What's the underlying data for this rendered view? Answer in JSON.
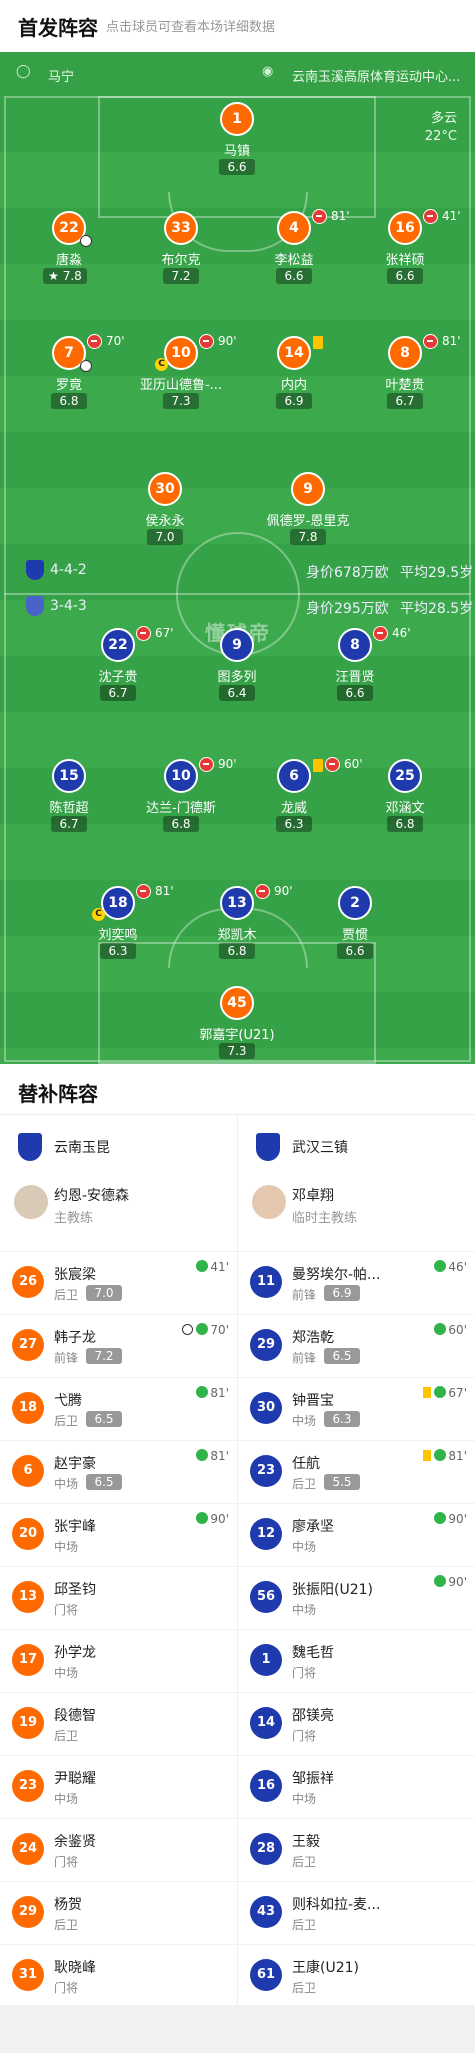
{
  "header": {
    "title": "首发阵容",
    "subtitle": "点击球员可查看本场详细数据"
  },
  "match": {
    "referee": "马宁",
    "venue": "云南玉溪高原体育运动中心...",
    "weather": "多云",
    "temperature": "22°C"
  },
  "teams": {
    "home": {
      "formation": "4-4-2",
      "value": "身价678万欧",
      "avg_age": "平均29.5岁",
      "color": "#ff6a00"
    },
    "away": {
      "formation": "3-4-3",
      "value": "身价295万欧",
      "avg_age": "平均28.5岁",
      "color": "#1e3aad"
    }
  },
  "watermark": "懂球帝",
  "home_players": [
    {
      "num": "1",
      "name": "马镇",
      "rating": "6.6"
    },
    {
      "num": "22",
      "name": "唐淼",
      "rating": "7.8"
    },
    {
      "num": "33",
      "name": "布尔克",
      "rating": "7.2"
    },
    {
      "num": "4",
      "name": "李松益",
      "rating": "6.6",
      "sub": "81'"
    },
    {
      "num": "16",
      "name": "张祥硕",
      "rating": "6.6",
      "sub": "41'"
    },
    {
      "num": "7",
      "name": "罗竟",
      "rating": "6.8",
      "sub": "70'"
    },
    {
      "num": "10",
      "name": "亚历山德鲁-...",
      "rating": "7.3",
      "sub": "90'"
    },
    {
      "num": "14",
      "name": "内内",
      "rating": "6.9"
    },
    {
      "num": "8",
      "name": "叶楚贵",
      "rating": "6.7",
      "sub": "81'"
    },
    {
      "num": "30",
      "name": "侯永永",
      "rating": "7.0"
    },
    {
      "num": "9",
      "name": "佩德罗-恩里克",
      "rating": "7.8"
    }
  ],
  "away_players": [
    {
      "num": "22",
      "name": "沈子贵",
      "rating": "6.7",
      "sub": "67'"
    },
    {
      "num": "9",
      "name": "图多列",
      "rating": "6.4"
    },
    {
      "num": "8",
      "name": "汪晋贤",
      "rating": "6.6",
      "sub": "46'"
    },
    {
      "num": "15",
      "name": "陈哲超",
      "rating": "6.7"
    },
    {
      "num": "10",
      "name": "达兰-门德斯",
      "rating": "6.8",
      "sub": "90'"
    },
    {
      "num": "6",
      "name": "龙威",
      "rating": "6.3",
      "sub": "60'"
    },
    {
      "num": "25",
      "name": "邓涵文",
      "rating": "6.8"
    },
    {
      "num": "18",
      "name": "刘奕鸣",
      "rating": "6.3",
      "sub": "81'"
    },
    {
      "num": "13",
      "name": "郑凯木",
      "rating": "6.8",
      "sub": "90'"
    },
    {
      "num": "2",
      "name": "贾惯",
      "rating": "6.6"
    },
    {
      "num": "45",
      "name": "郭嘉宇(U21)",
      "rating": "7.3"
    }
  ],
  "bench": {
    "title": "替补阵容",
    "home": {
      "team": "云南玉昆",
      "coach": "约恩-安德森",
      "coach_role": "主教练",
      "players": [
        {
          "num": "26",
          "name": "张宸梁",
          "pos": "后卫",
          "rating": "7.0",
          "in": "41'"
        },
        {
          "num": "27",
          "name": "韩子龙",
          "pos": "前锋",
          "rating": "7.2",
          "in": "70'"
        },
        {
          "num": "18",
          "name": "弋腾",
          "pos": "后卫",
          "rating": "6.5",
          "in": "81'"
        },
        {
          "num": "6",
          "name": "赵宇豪",
          "pos": "中场",
          "rating": "6.5",
          "in": "81'"
        },
        {
          "num": "20",
          "name": "张宇峰",
          "pos": "中场",
          "in": "90'"
        },
        {
          "num": "13",
          "name": "邱圣钧",
          "pos": "门将"
        },
        {
          "num": "17",
          "name": "孙学龙",
          "pos": "中场"
        },
        {
          "num": "19",
          "name": "段德智",
          "pos": "后卫"
        },
        {
          "num": "23",
          "name": "尹聪耀",
          "pos": "中场"
        },
        {
          "num": "24",
          "name": "余鉴贤",
          "pos": "门将"
        },
        {
          "num": "29",
          "name": "杨贺",
          "pos": "后卫"
        },
        {
          "num": "31",
          "name": "耿晓峰",
          "pos": "门将"
        }
      ]
    },
    "away": {
      "team": "武汉三镇",
      "coach": "邓卓翔",
      "coach_role": "临时主教练",
      "players": [
        {
          "num": "11",
          "name": "曼努埃尔-帕...",
          "pos": "前锋",
          "rating": "6.9",
          "in": "46'"
        },
        {
          "num": "29",
          "name": "郑浩乾",
          "pos": "前锋",
          "rating": "6.5",
          "in": "60'"
        },
        {
          "num": "30",
          "name": "钟晋宝",
          "pos": "中场",
          "rating": "6.3",
          "in": "67'"
        },
        {
          "num": "23",
          "name": "任航",
          "pos": "后卫",
          "rating": "5.5",
          "in": "81'"
        },
        {
          "num": "12",
          "name": "廖承坚",
          "pos": "中场",
          "in": "90'"
        },
        {
          "num": "56",
          "name": "张振阳(U21)",
          "pos": "中场",
          "in": "90'"
        },
        {
          "num": "1",
          "name": "魏毛哲",
          "pos": "门将"
        },
        {
          "num": "14",
          "name": "邵镁亮",
          "pos": "门将"
        },
        {
          "num": "16",
          "name": "邹振祥",
          "pos": "中场"
        },
        {
          "num": "28",
          "name": "王毅",
          "pos": "后卫"
        },
        {
          "num": "43",
          "name": "则科如拉-麦...",
          "pos": "后卫"
        },
        {
          "num": "61",
          "name": "王康(U21)",
          "pos": "后卫"
        }
      ]
    }
  }
}
